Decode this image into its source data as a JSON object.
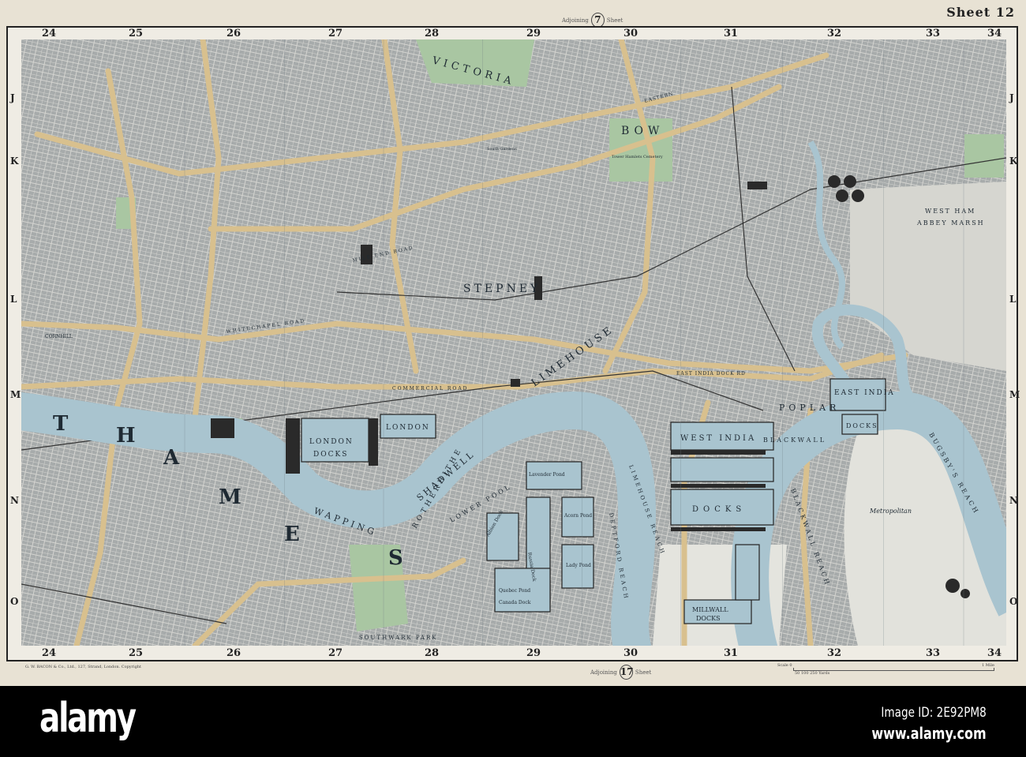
{
  "sheet": {
    "title": "Sheet 12",
    "adjoining_top": {
      "prefix": "Adjoining",
      "number": "7",
      "suffix": "Sheet"
    },
    "adjoining_bottom": {
      "prefix": "Adjoining",
      "number": "17",
      "suffix": "Sheet"
    },
    "publisher": "G. W. BACON & Co., Ltd., 127, Strand, London.   Copyright",
    "scale": {
      "label": "Scale 0",
      "end": "1 Mile",
      "sub": "50 100   250 Yards"
    }
  },
  "grid": {
    "columns": [
      "24",
      "25",
      "26",
      "27",
      "28",
      "29",
      "30",
      "31",
      "32",
      "33",
      "34"
    ],
    "rows": [
      "J",
      "K",
      "L",
      "M",
      "N",
      "O"
    ]
  },
  "map_labels": {
    "thames": [
      "T",
      "H",
      "A",
      "M",
      "E",
      "S"
    ],
    "london_docks": "LONDON",
    "london_docks2": "DOCKS",
    "london_docks_east": "LONDON",
    "wapping": "WAPPING",
    "shadwell": "SHADWELL",
    "lower_pool": "LOWER POOL",
    "stepney": "STEPNEY",
    "limehouse": "LIMEHOUSE",
    "poplar": "POPLAR",
    "bow": "BOW",
    "victoria": "VICTORIA",
    "west_india": "WEST INDIA",
    "west_india2": "DOCKS",
    "east_india": "EAST INDIA",
    "east_india2": "DOCKS",
    "millwall": "MILLWALL",
    "millwall2": "DOCKS",
    "blackwall": "BLACKWALL",
    "blackwall_reach": "BLACKWALL REACH",
    "bugsbys_reach": "BUGSBY'S REACH",
    "metropolitan": "Metropolitan",
    "west_ham": "WEST HAM",
    "abbey_marsh": "ABBEY MARSH",
    "lavender_pond": "Lavender Pond",
    "acorn_pond": "Acorn Pond",
    "lady_pond": "Lady Pond",
    "quebec_pond": "Quebec Pond",
    "russia_dock": "Russia Dock",
    "albion_dock": "Albion Dock",
    "canada_dock": "Canada Dock",
    "cornhill": "CORNHILL",
    "whitechapel_road": "WHITECHAPEL ROAD",
    "commercial_road": "COMMERCIAL ROAD",
    "mile_end_road": "MILE END ROAD",
    "east_india_dock_rd": "EAST INDIA DOCK RD",
    "eastern": "EASTERN",
    "south_gardens": "South Gardens",
    "cemetery": "Tower Hamlets Cemetery",
    "deptford_reach": "DEPTFORD REACH",
    "limehouse_reach": "LIMEHOUSE REACH",
    "rotherhithe": "ROTHERHITHE",
    "southwark_park": "SOUTHWARK PARK"
  },
  "colors": {
    "land": "#a9adad",
    "river": "#a9c4cf",
    "road": "#d8c08e",
    "park": "#a9c6a2",
    "building": "#2a2a2a",
    "paper": "#e8e2d4"
  },
  "watermark": {
    "logo": "alamy",
    "image_id": "Image ID: 2E92PM8",
    "url": "www.alamy.com"
  }
}
